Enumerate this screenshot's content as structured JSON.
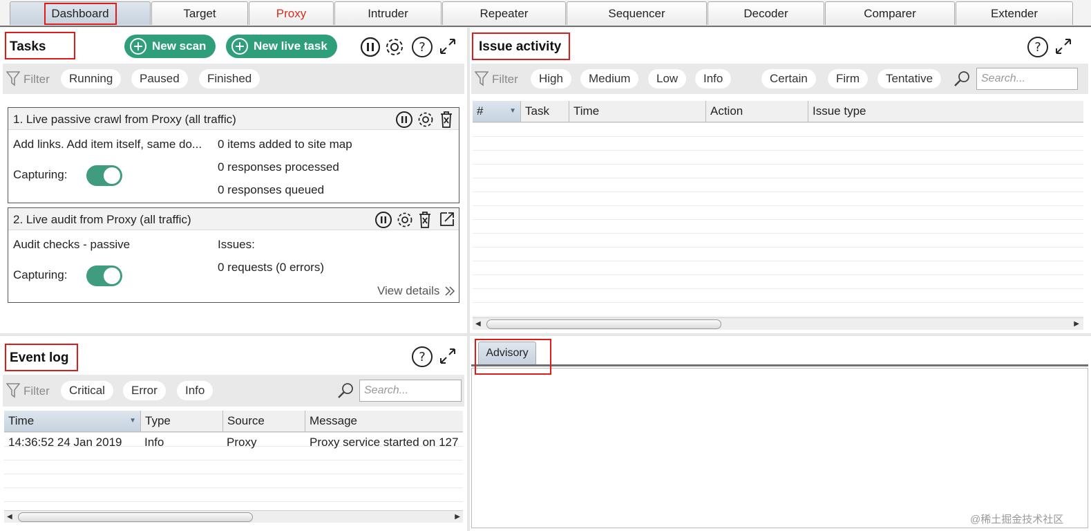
{
  "tabs": [
    {
      "label": "Dashboard",
      "active": true
    },
    {
      "label": "Target"
    },
    {
      "label": "Proxy"
    },
    {
      "label": "Intruder"
    },
    {
      "label": "Repeater"
    },
    {
      "label": "Sequencer"
    },
    {
      "label": "Decoder"
    },
    {
      "label": "Comparer"
    },
    {
      "label": "Extender"
    }
  ],
  "tasks": {
    "title": "Tasks",
    "new_scan": "New scan",
    "new_live_task": "New live task",
    "filter_label": "Filter",
    "filters": [
      "Running",
      "Paused",
      "Finished"
    ],
    "cards": [
      {
        "title": "1. Live passive crawl from Proxy (all traffic)",
        "left_line": "Add links. Add item itself, same do...",
        "capturing_label": "Capturing:",
        "stats": [
          "0 items added to site map",
          "0 responses processed",
          "0 responses queued"
        ],
        "capturing": true
      },
      {
        "title": "2. Live audit from Proxy (all traffic)",
        "left_line": "Audit checks - passive",
        "capturing_label": "Capturing:",
        "stats": [
          "Issues:",
          "0 requests (0 errors)"
        ],
        "view_details": "View details",
        "capturing": true
      }
    ]
  },
  "issue_activity": {
    "title": "Issue activity",
    "filter_label": "Filter",
    "severity_filters": [
      "High",
      "Medium",
      "Low",
      "Info"
    ],
    "confidence_filters": [
      "Certain",
      "Firm",
      "Tentative"
    ],
    "search_placeholder": "Search...",
    "columns": [
      "#",
      "Task",
      "Time",
      "Action",
      "Issue type"
    ]
  },
  "advisory": {
    "tab_label": "Advisory"
  },
  "event_log": {
    "title": "Event log",
    "filter_label": "Filter",
    "filters": [
      "Critical",
      "Error",
      "Info"
    ],
    "search_placeholder": "Search...",
    "columns": [
      "Time",
      "Type",
      "Source",
      "Message"
    ],
    "rows": [
      {
        "time": "14:36:52 24 Jan 2019",
        "type": "Info",
        "source": "Proxy",
        "message": "Proxy service started on 127"
      }
    ]
  },
  "watermark": "@稀土掘金技术社区",
  "colors": {
    "accent_green": "#2f9e7b",
    "highlight_red": "#e0191a",
    "proxy_tab_text": "#d9291c"
  }
}
